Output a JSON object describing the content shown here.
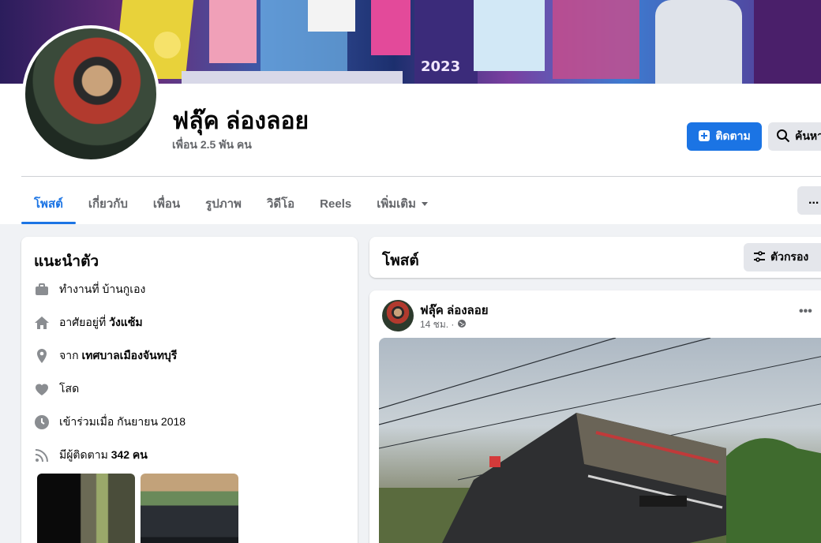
{
  "profile": {
    "name": "ฟลุ๊ค ล่องลอย",
    "friends": "เพื่อน 2.5 พัน คน",
    "cover_year": "2023"
  },
  "actions": {
    "follow_label": "ติดตาม",
    "search_label": "ค้นหา",
    "more_label": "..."
  },
  "tabs": [
    {
      "label": "โพสต์"
    },
    {
      "label": "เกี่ยวกับ"
    },
    {
      "label": "เพื่อน"
    },
    {
      "label": "รูปภาพ"
    },
    {
      "label": "วิดีโอ"
    },
    {
      "label": "Reels"
    },
    {
      "label": "เพิ่มเติม"
    }
  ],
  "intro": {
    "title": "แนะนำตัว",
    "work": {
      "prefix": "ทำงานที่ ",
      "value": "บ้านกูเอง"
    },
    "lives": {
      "prefix": "อาศัยอยู่ที่ ",
      "value": "วังแซ้ม"
    },
    "from": {
      "prefix": "จาก ",
      "value": "เทศบาลเมืองจันทบุรี"
    },
    "relationship": "โสด",
    "joined": "เข้าร่วมเมื่อ กันยายน 2018",
    "followers": {
      "prefix": "มีผู้ติดตาม ",
      "value": "342 คน"
    }
  },
  "posts_section": {
    "title": "โพสต์",
    "filter_label": "ตัวกรอง"
  },
  "post": {
    "author": "ฟลุ๊ค ล่องลอย",
    "time": "14 ชม. ·"
  },
  "colors": {
    "accent": "#1b74e4",
    "background": "#f0f2f5",
    "secondary_text": "#65676b"
  }
}
